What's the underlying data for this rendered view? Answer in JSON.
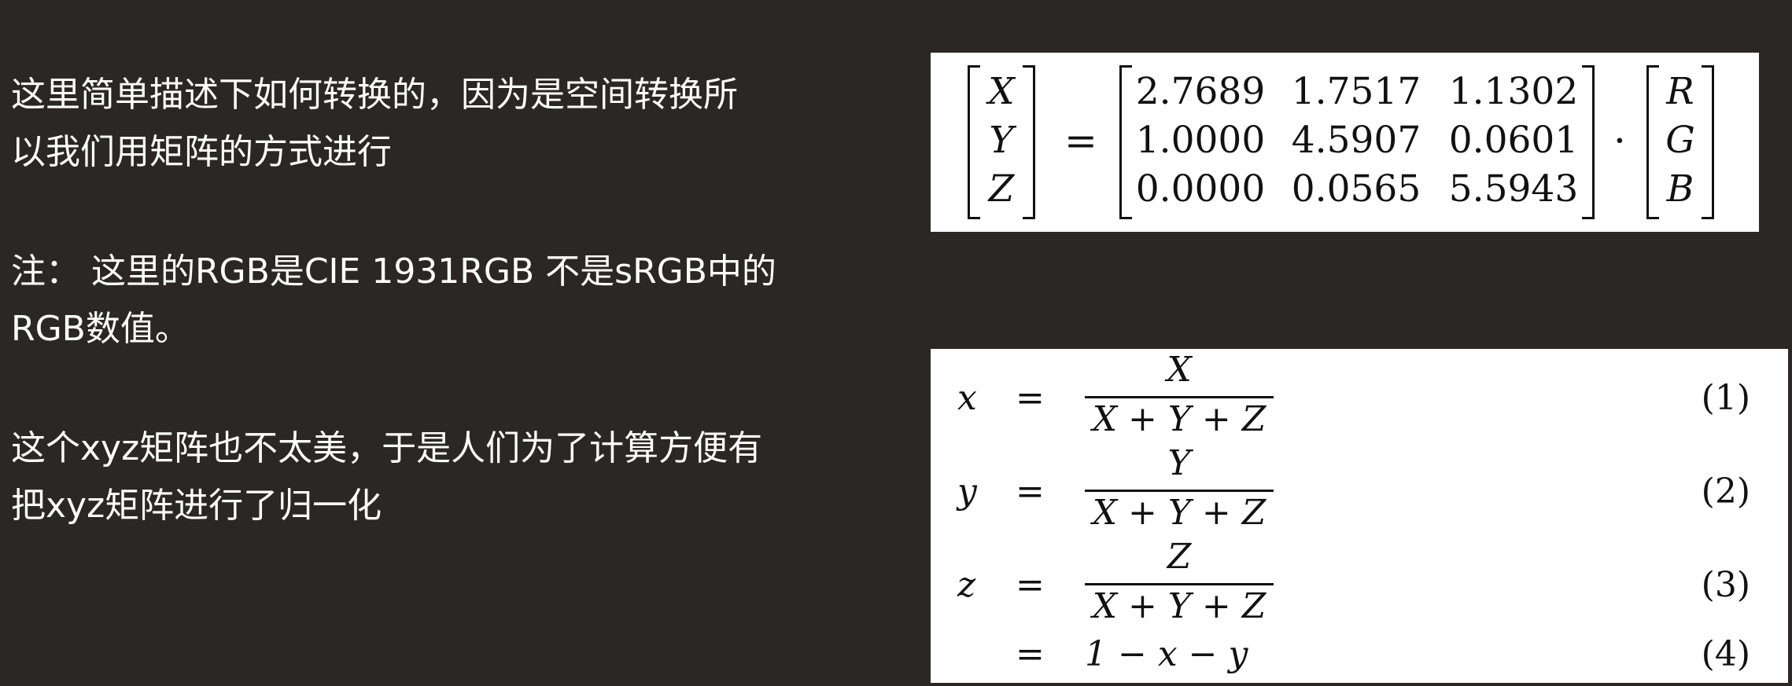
{
  "notes": {
    "p1_line1": "这里简单描述下如何转换的，因为是空间转换所",
    "p1_line2": "以我们用矩阵的方式进行",
    "p2_line1": "注： 这里的RGB是CIE 1931RGB 不是sRGB中的",
    "p2_line2": "RGB数值。",
    "p3_line1": "这个xyz矩阵也不太美，于是人们为了计算方便有",
    "p3_line2": "把xyz矩阵进行了归一化"
  },
  "matrix_equation": {
    "lhs": [
      "X",
      "Y",
      "Z"
    ],
    "equals": "=",
    "matrix": [
      [
        "2.7689",
        "1.7517",
        "1.1302"
      ],
      [
        "1.0000",
        "4.5907",
        "0.0601"
      ],
      [
        "0.0000",
        "0.0565",
        "5.5943"
      ]
    ],
    "dot": "·",
    "rhs": [
      "R",
      "G",
      "B"
    ]
  },
  "chromaticity": {
    "rows": [
      {
        "lhs": "x",
        "eq": "=",
        "num": "X",
        "den": "X + Y + Z",
        "tag": "(1)"
      },
      {
        "lhs": "y",
        "eq": "=",
        "num": "Y",
        "den": "X + Y + Z",
        "tag": "(2)"
      },
      {
        "lhs": "z",
        "eq": "=",
        "num": "Z",
        "den": "X + Y + Z",
        "tag": "(3)"
      }
    ],
    "last": {
      "eq": "=",
      "expr": "1 − x − y",
      "tag": "(4)"
    }
  }
}
